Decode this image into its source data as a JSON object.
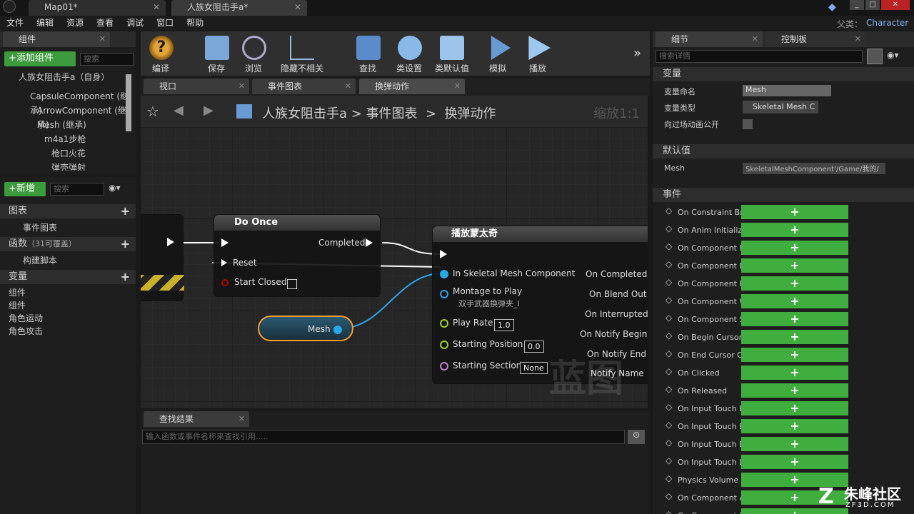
{
  "window": {
    "tabs": [
      "Map01*",
      "人族女阻击手a*"
    ],
    "parent_label": "父类：",
    "parent_value": "Character",
    "controls": [
      "_",
      "□",
      "✕"
    ]
  },
  "menu": [
    "文件",
    "编辑",
    "资源",
    "查看",
    "调试",
    "窗口",
    "帮助"
  ],
  "components_panel": {
    "tab": "组件",
    "add_button": "+添加组件",
    "search_placeholder": "搜索",
    "self_label": "人族女阻击手a（自身）",
    "tree": [
      "CapsuleComponent (继承)",
      "ArrowComponent (继承)",
      "Mesh (继承)",
      "m4a1步枪",
      "枪口火花",
      "弹壳弹射"
    ]
  },
  "my_blueprint": {
    "new_button": "+新增",
    "search_placeholder": "搜索",
    "graphs_label": "图表",
    "event_graph": "事件图表",
    "functions_label": "函数",
    "functions_count": "（31可覆盖）",
    "construction_script": "构建脚本",
    "variables_label": "变量",
    "variables": [
      "组件",
      "组件",
      "角色运动",
      "角色攻击"
    ]
  },
  "toolbar": [
    {
      "label": "编译",
      "icon": "compile-icon"
    },
    {
      "label": "保存",
      "icon": "save-icon"
    },
    {
      "label": "浏览",
      "icon": "browse-icon"
    },
    {
      "label": "隐藏不相关",
      "icon": "hide-unrelated-icon"
    },
    {
      "label": "查找",
      "icon": "find-icon"
    },
    {
      "label": "类设置",
      "icon": "class-settings-icon"
    },
    {
      "label": "类默认值",
      "icon": "class-defaults-icon"
    },
    {
      "label": "模拟",
      "icon": "simulate-icon"
    },
    {
      "label": "播放",
      "icon": "play-icon"
    }
  ],
  "editor_tabs": [
    "视口",
    "事件图表",
    "换弹动作"
  ],
  "breadcrumb": [
    "人族女阻击手a",
    "事件图表",
    "换弹动作"
  ],
  "zoom": "缩放1:1",
  "graph": {
    "do_once": {
      "title": "Do Once",
      "completed": "Completed",
      "reset": "Reset",
      "start_closed": "Start Closed"
    },
    "mesh_var": "Mesh",
    "play_montage": {
      "title": "播放蒙太奇",
      "in_mesh": "In Skeletal Mesh Component",
      "montage": "Montage to Play",
      "montage_value": "双手武器换弹夹_I",
      "play_rate": "Play Rate",
      "play_rate_value": "1.0",
      "starting_position": "Starting Position",
      "starting_position_value": "0.0",
      "starting_section": "Starting Section",
      "starting_section_value": "None",
      "outputs": [
        "On Completed",
        "On Blend Out",
        "On Interrupted",
        "On Notify Begin",
        "On Notify End",
        "Notify Name"
      ]
    },
    "watermark": "蓝图"
  },
  "find_results": {
    "tab": "查找结果",
    "placeholder": "输入函数或事件名称来查找引用....."
  },
  "details": {
    "tabs": [
      "细节",
      "控制板"
    ],
    "search_placeholder": "搜索详情",
    "variable_section": "变量",
    "var_name_label": "变量命名",
    "var_name_value": "Mesh",
    "var_type_label": "变量类型",
    "var_type_value": "Skeletal Mesh C",
    "expose_label": "向过场动画公开",
    "default_section": "默认值",
    "default_mesh_label": "Mesh",
    "default_mesh_value": "SkeletalMeshComponent'/Game/我的/",
    "events_section": "事件",
    "events": [
      "On Constraint Br",
      "On Anim Initializ",
      "On Component H",
      "On Component B",
      "On Component E",
      "On Component W",
      "On Component S",
      "On Begin Cursor",
      "On End Cursor O",
      "On Clicked",
      "On Released",
      "On Input Touch E",
      "On Input Touch E",
      "On Input Touch E",
      "On Input Touch L",
      "Physics Volume",
      "On Component A",
      "On Component D"
    ]
  },
  "logo": {
    "brand": "朱峰社区",
    "site": "ZF3D.COM"
  }
}
